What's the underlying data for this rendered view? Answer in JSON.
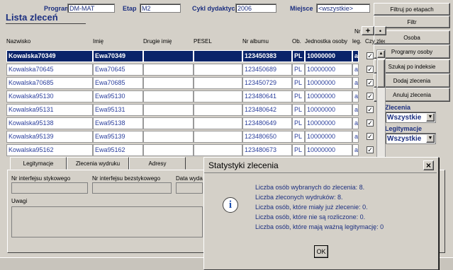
{
  "header": {
    "program_label": "Program",
    "program_value": "DM-MAT",
    "etap_label": "Etap",
    "etap_value": "M2",
    "cykl_label": "Cykl dydaktyczny",
    "cykl_value": "2006",
    "miejsce_label": "Miejsce",
    "miejsce_value": "<wszystkie>",
    "list_title": "Lista zleceń"
  },
  "side": {
    "btn_filtr_etap": "Filtruj po etapach",
    "btn_filtr": "Filtr",
    "btn_osoba": "Osoba",
    "btn_programy": "Programy osoby",
    "btn_szukaj": "Szukaj po indeksie",
    "btn_dodaj": "Dodaj zlecenia",
    "btn_anuluj": "Anuluj zlecenia",
    "zlecenia_label": "Zlecenia",
    "zlecenia_value": "Wszystkie",
    "legitymacje_label": "Legitymacje",
    "legitymacje_value": "Wszystkie"
  },
  "grid": {
    "col_nr": "Nr",
    "col_nazwisko": "Nazwisko",
    "col_imie": "Imię",
    "col_drugie": "Drugie imię",
    "col_pesel": "PESEL",
    "col_album": "Nr albumu",
    "col_ob": "Ob.",
    "col_jednostka": "Jednostka osoby",
    "col_leg": "leg.",
    "col_czy": "Czy zleco",
    "add_symbol": "+",
    "dot_symbol": "•",
    "check_symbol": "✓",
    "rows": [
      {
        "nazwisko": "Kowalska70349",
        "imie": "Ewa70349",
        "drugie": "",
        "pesel": "",
        "album": "123450383",
        "ob": "PL",
        "jednostka": "10000000",
        "leg": "a"
      },
      {
        "nazwisko": "Kowalska70645",
        "imie": "Ewa70645",
        "drugie": "",
        "pesel": "",
        "album": "123450689",
        "ob": "PL",
        "jednostka": "10000000",
        "leg": "a"
      },
      {
        "nazwisko": "Kowalska70685",
        "imie": "Ewa70685",
        "drugie": "",
        "pesel": "",
        "album": "123450729",
        "ob": "PL",
        "jednostka": "10000000",
        "leg": "a"
      },
      {
        "nazwisko": "Kowalska95130",
        "imie": "Ewa95130",
        "drugie": "",
        "pesel": "",
        "album": "123480641",
        "ob": "PL",
        "jednostka": "10000000",
        "leg": "a"
      },
      {
        "nazwisko": "Kowalska95131",
        "imie": "Ewa95131",
        "drugie": "",
        "pesel": "",
        "album": "123480642",
        "ob": "PL",
        "jednostka": "10000000",
        "leg": "a"
      },
      {
        "nazwisko": "Kowalska95138",
        "imie": "Ewa95138",
        "drugie": "",
        "pesel": "",
        "album": "123480649",
        "ob": "PL",
        "jednostka": "10000000",
        "leg": "a"
      },
      {
        "nazwisko": "Kowalska95139",
        "imie": "Ewa95139",
        "drugie": "",
        "pesel": "",
        "album": "123480650",
        "ob": "PL",
        "jednostka": "10000000",
        "leg": "a"
      },
      {
        "nazwisko": "Kowalska95162",
        "imie": "Ewa95162",
        "drugie": "",
        "pesel": "",
        "album": "123480673",
        "ob": "PL",
        "jednostka": "10000000",
        "leg": "a"
      }
    ]
  },
  "tabs": {
    "legitymacje": "Legitymacje",
    "zlecenia": "Zlecenia wydruku",
    "adresy": "Adresy"
  },
  "lower": {
    "nr_styk": "Nr interfejsu stykowego",
    "nr_bezstyk": "Nr interfejsu bezstykowego",
    "data": "Data wyda",
    "uwagi": "Uwagi"
  },
  "dialog": {
    "title": "Statystyki zlecenia",
    "close": "×",
    "info_icon": "i",
    "line1": "Liczba osób wybranych do zlecenia: 8.",
    "line2": "Liczba zleconych wydruków: 8.",
    "line3": "Liczba osób, które miały już zlecenie: 0.",
    "line4": "Liczba osób, które nie są rozliczone: 0.",
    "line5": "Liczba osób, które mają ważną legitymację: 0",
    "ok": "OK"
  },
  "icons": {
    "info": "info-icon",
    "close": "close-icon",
    "dropdown": "chevron-down-icon",
    "scroll_up": "scroll-up-icon",
    "scroll_down": "scroll-down-icon"
  }
}
